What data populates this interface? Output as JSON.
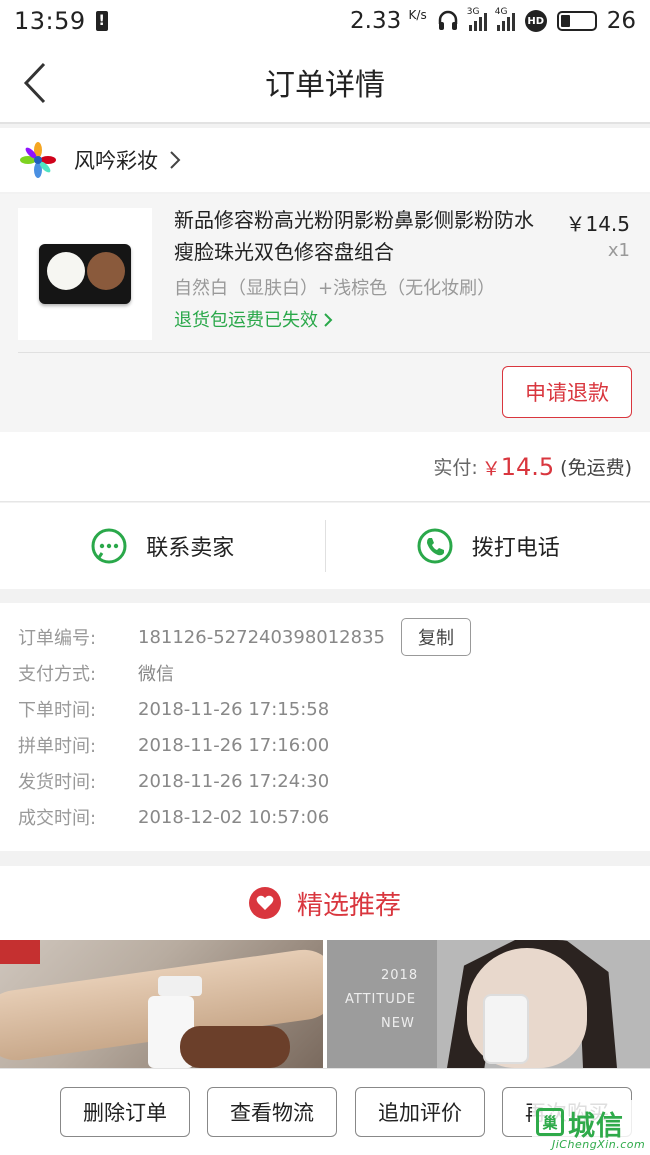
{
  "status_bar": {
    "time": "13:59",
    "network_speed": "2.33",
    "speed_unit": "K/s",
    "sim1_label": "3G",
    "sim2_label": "4G",
    "hd_label": "HD",
    "battery": "26"
  },
  "nav": {
    "title": "订单详情",
    "back_icon": "chevron-left-icon"
  },
  "shop": {
    "name": "风吟彩妆",
    "logo_icon": "flower-logo-icon"
  },
  "product": {
    "title": "新品修容粉高光粉阴影粉鼻影侧影粉防水瘦脸珠光双色修容盘组合",
    "price": "￥14.5",
    "quantity": "x1",
    "sku": "自然白（显肤白）+浅棕色（无化妆刷）",
    "policy": "退货包运费已失效",
    "refund_button": "申请退款",
    "colors": {
      "white": "#f6f6f2",
      "brown": "#8a5a3c"
    }
  },
  "payment": {
    "label": "实付:",
    "currency": "￥",
    "amount": "14.5",
    "shipping": "(免运费)"
  },
  "contact": {
    "seller": "联系卖家",
    "call": "拨打电话"
  },
  "order_info": {
    "rows": [
      {
        "key": "订单编号:",
        "value": "181126-527240398012835"
      },
      {
        "key": "支付方式:",
        "value": "微信"
      },
      {
        "key": "下单时间:",
        "value": "2018-11-26 17:15:58"
      },
      {
        "key": "拼单时间:",
        "value": "2018-11-26 17:16:00"
      },
      {
        "key": "发货时间:",
        "value": "2018-11-26 17:24:30"
      },
      {
        "key": "成交时间:",
        "value": "2018-12-02 10:57:06"
      }
    ],
    "copy_button": "复制"
  },
  "recommend": {
    "title": "精选推荐",
    "img2_lines": [
      "2018",
      "ATTITUDE",
      "NEW"
    ]
  },
  "actions": {
    "delete": "删除订单",
    "logistics": "查看物流",
    "review": "追加评价",
    "rebuy": "再次购买"
  },
  "watermark": {
    "icon_char": "巢",
    "text": "城信",
    "sub": "JiChengXin.com"
  },
  "colors": {
    "accent_red": "#d9363e",
    "accent_green": "#2aa84a"
  }
}
